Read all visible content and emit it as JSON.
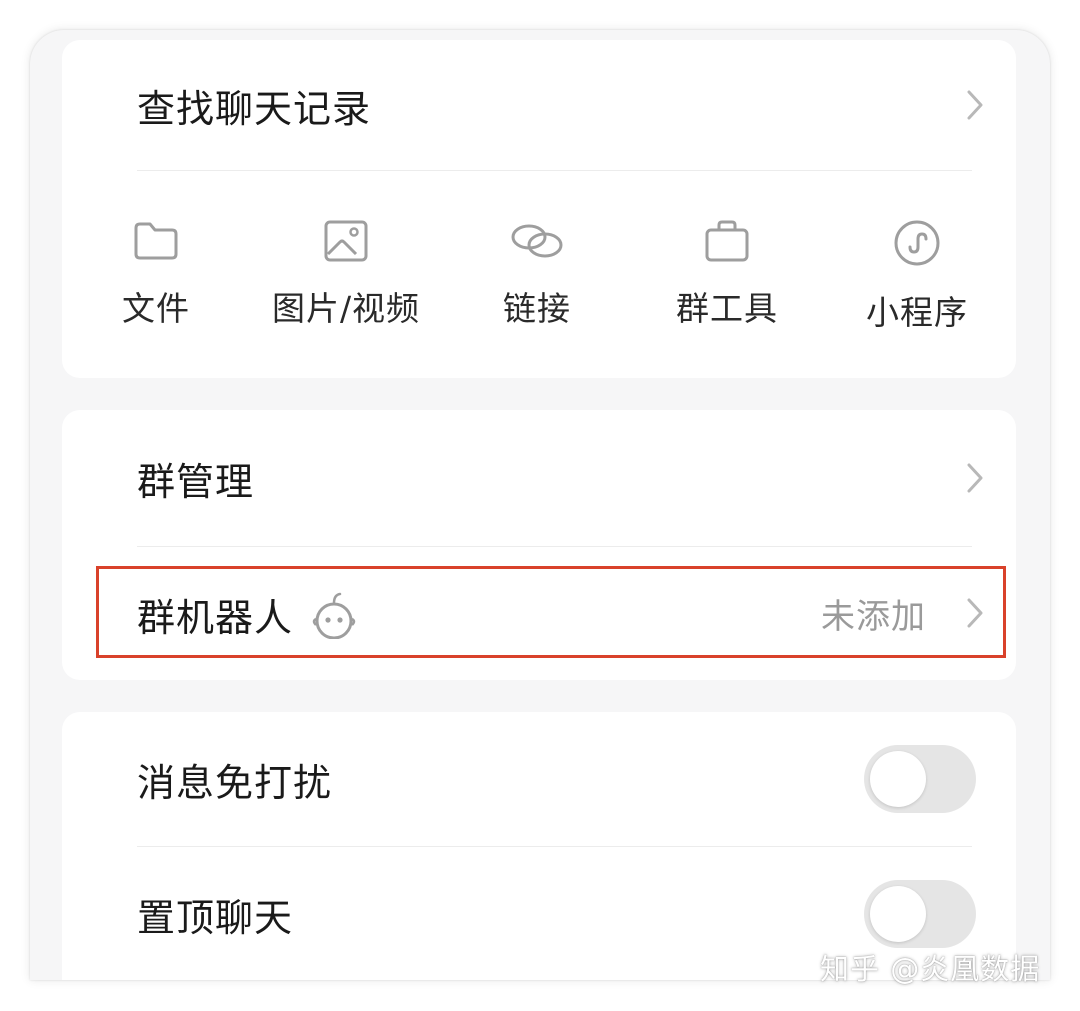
{
  "search_history": {
    "label": "查找聊天记录"
  },
  "quick_actions": [
    {
      "label": "文件",
      "icon": "folder-icon"
    },
    {
      "label": "图片/视频",
      "icon": "image-icon"
    },
    {
      "label": "链接",
      "icon": "link-icon"
    },
    {
      "label": "群工具",
      "icon": "briefcase-icon"
    },
    {
      "label": "小程序",
      "icon": "mini-program-icon"
    }
  ],
  "group_settings": {
    "manage_label": "群管理",
    "robot_label": "群机器人",
    "robot_icon": "robot-icon",
    "robot_status": "未添加"
  },
  "toggles": {
    "mute": {
      "label": "消息免打扰",
      "on": false
    },
    "pin": {
      "label": "置顶聊天",
      "on": false
    }
  },
  "watermark": "知乎 @炎凰数据",
  "colors": {
    "highlight_border": "#d9412a",
    "icon_gray": "#9e9e9e",
    "background": "#f6f6f7"
  }
}
